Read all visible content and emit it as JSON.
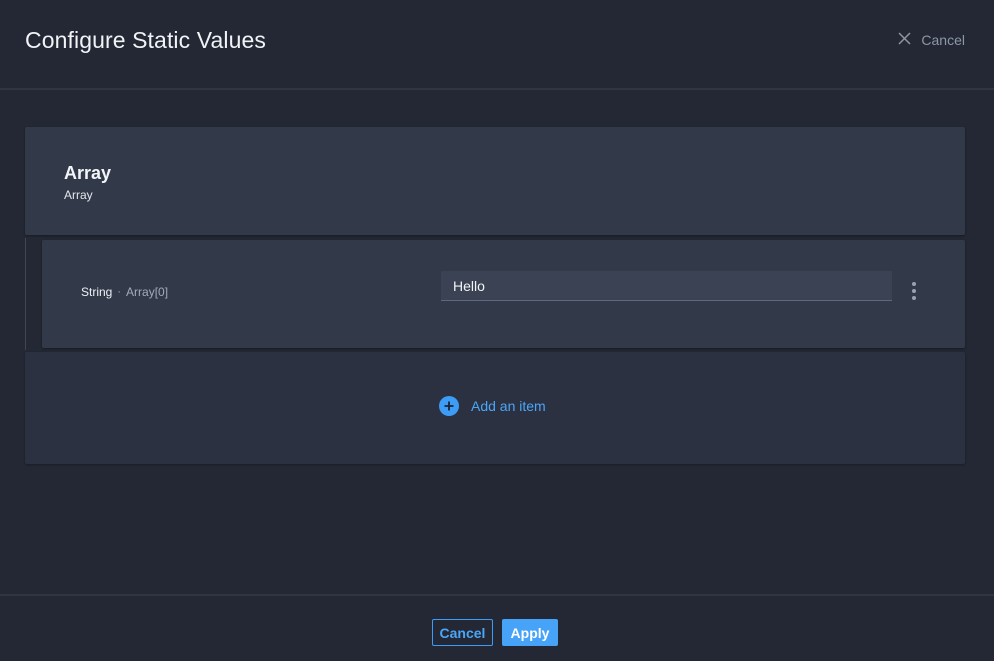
{
  "header": {
    "title": "Configure Static Values",
    "cancel_label": "Cancel"
  },
  "array": {
    "name": "Array",
    "type": "Array"
  },
  "items": [
    {
      "type": "String",
      "separator": "·",
      "path": "Array[0]",
      "value": "Hello"
    }
  ],
  "add_item": {
    "label": "Add an item",
    "icon": "plus-circle-icon"
  },
  "footer": {
    "cancel_label": "Cancel",
    "apply_label": "Apply"
  },
  "colors": {
    "background": "#232834",
    "card": "#323a4a",
    "accent": "#47a3f8"
  }
}
